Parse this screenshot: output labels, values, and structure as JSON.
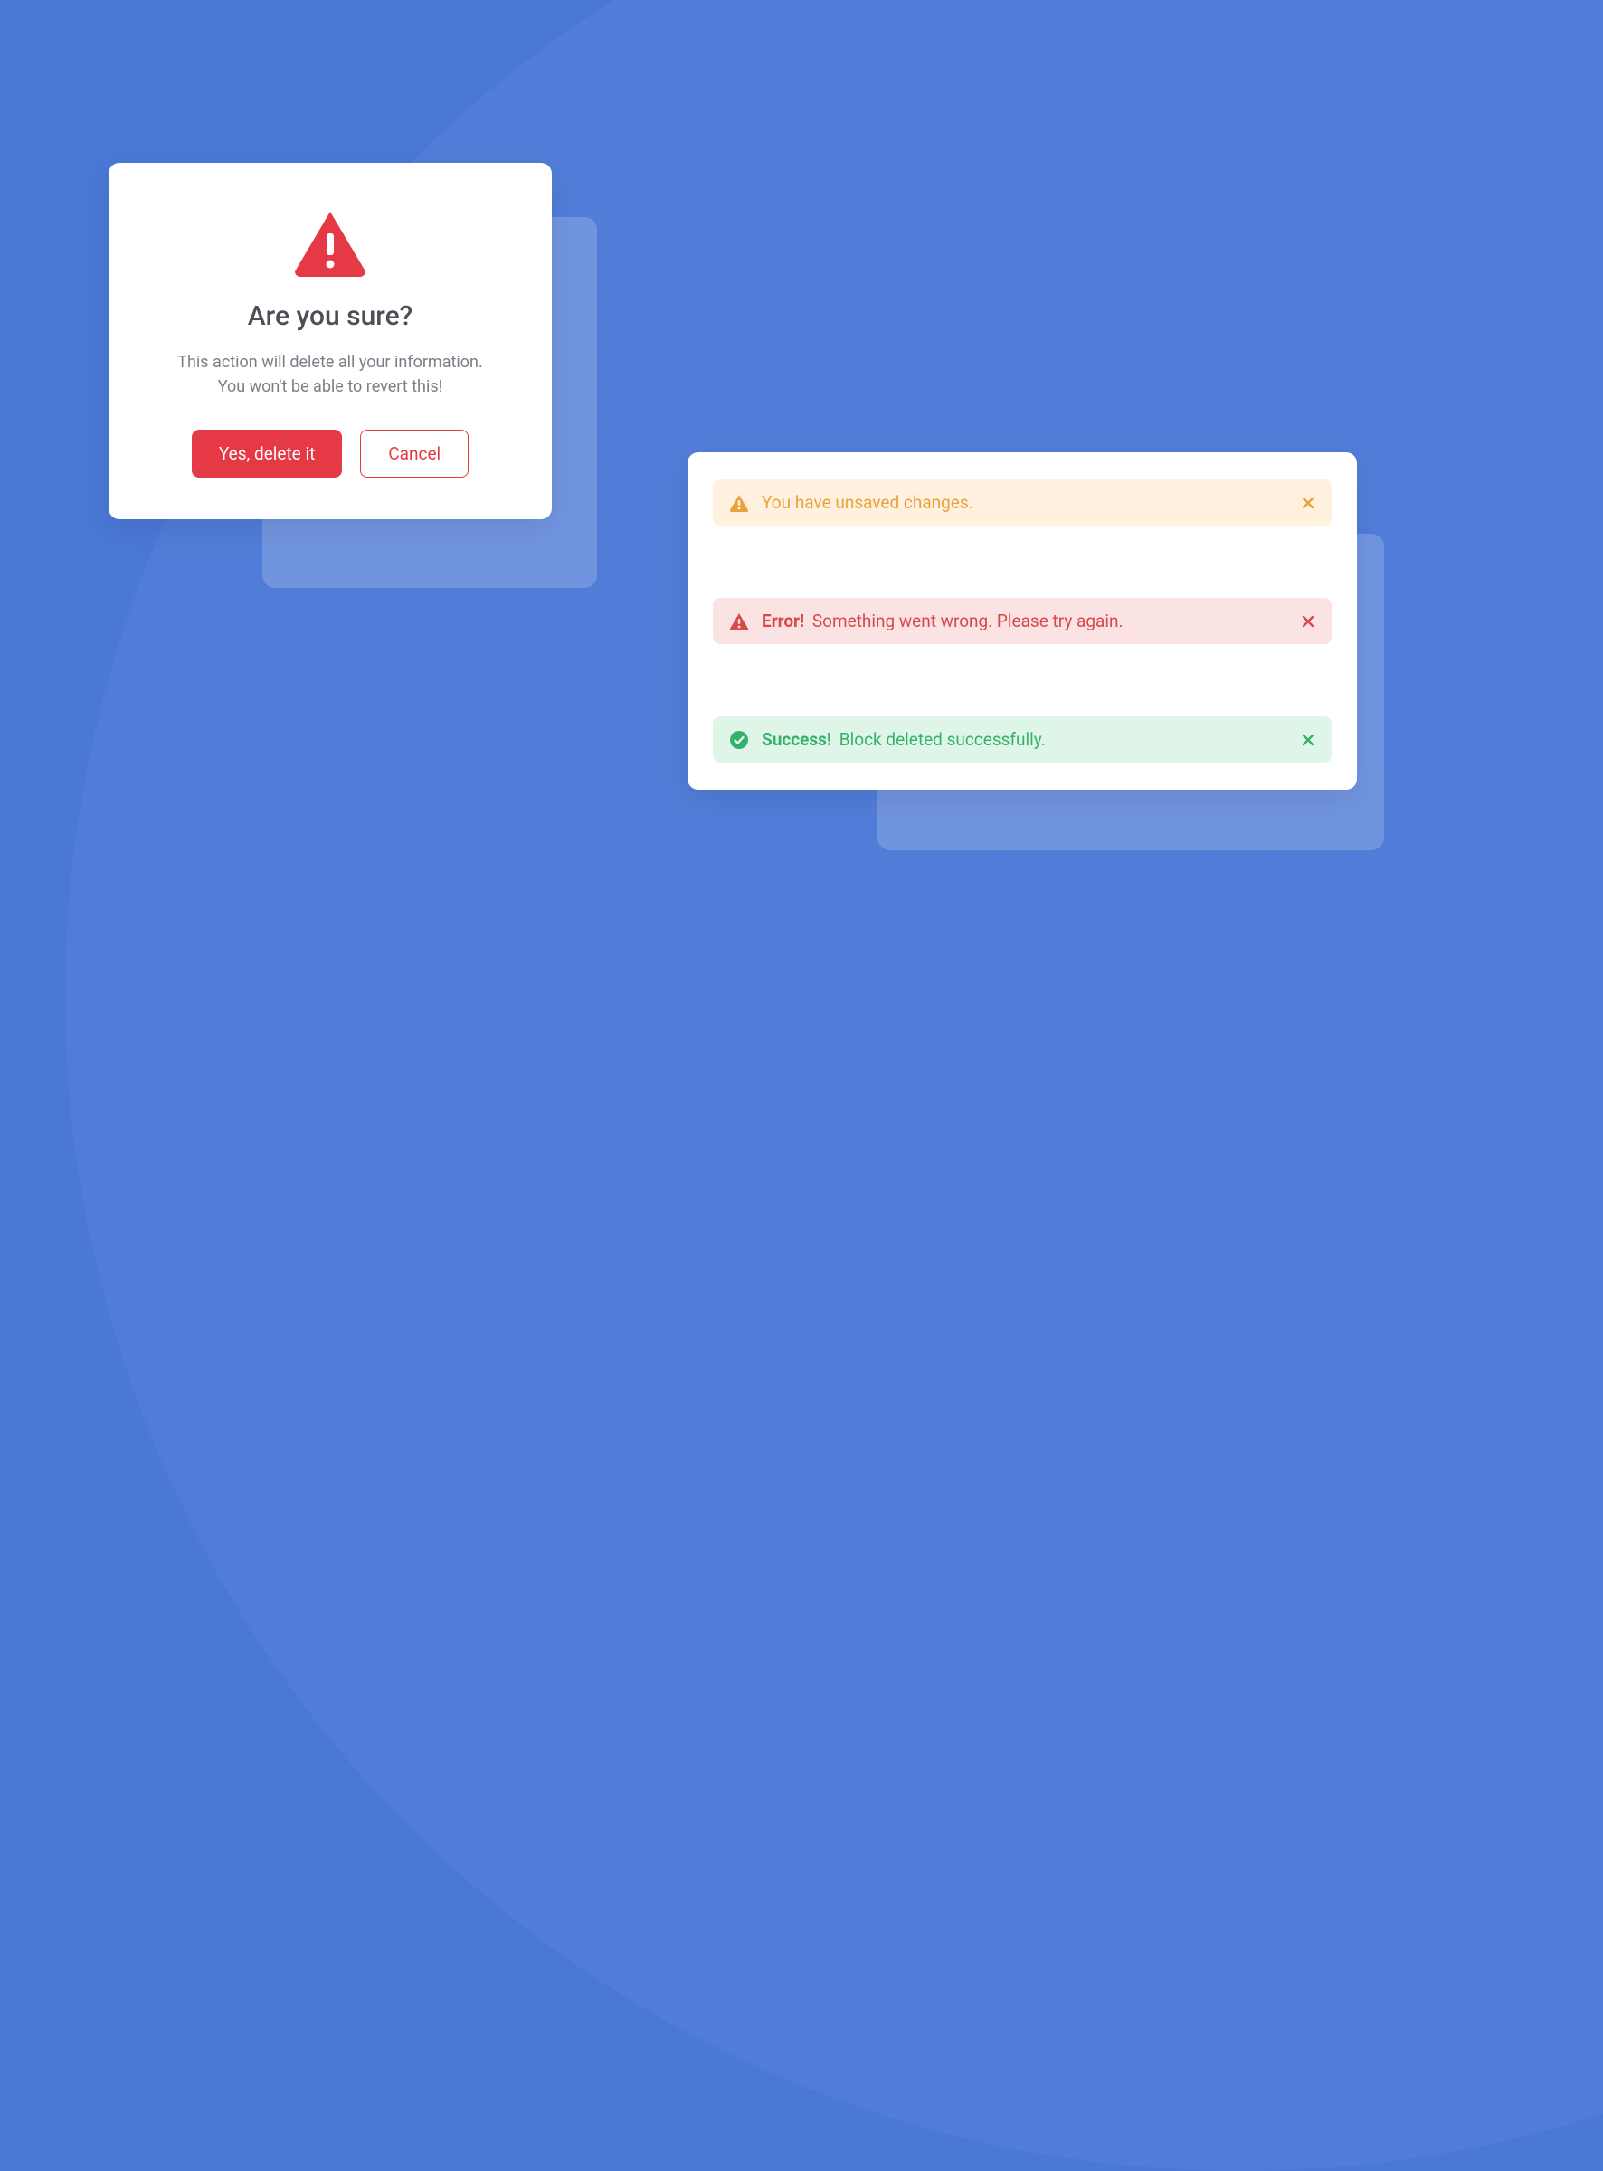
{
  "colors": {
    "background": "#4A78D6",
    "danger": "#E63946",
    "warning": "#E9A23B",
    "error": "#D84A4A",
    "success": "#34B26B"
  },
  "confirm": {
    "title": "Are you sure?",
    "message_line1": "This action will delete all your information.",
    "message_line2": "You won't be able to revert this!",
    "primary_label": "Yes, delete it",
    "secondary_label": "Cancel"
  },
  "alerts": {
    "warning": {
      "message": "You have unsaved changes."
    },
    "error": {
      "bold": "Error!",
      "message": "Something went wrong. Please try again."
    },
    "success": {
      "bold": "Success!",
      "message": "Block deleted successfully."
    }
  }
}
